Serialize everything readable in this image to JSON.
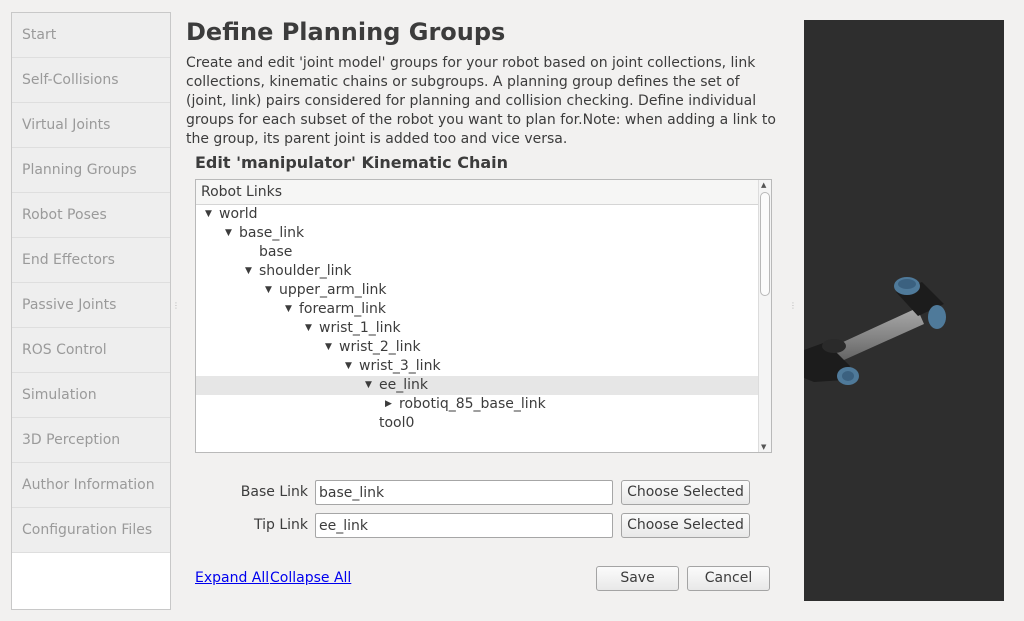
{
  "sidebar": {
    "items": [
      {
        "label": "Start"
      },
      {
        "label": "Self-Collisions"
      },
      {
        "label": "Virtual Joints"
      },
      {
        "label": "Planning Groups"
      },
      {
        "label": "Robot Poses"
      },
      {
        "label": "End Effectors"
      },
      {
        "label": "Passive Joints"
      },
      {
        "label": "ROS Control"
      },
      {
        "label": "Simulation"
      },
      {
        "label": "3D Perception"
      },
      {
        "label": "Author Information"
      },
      {
        "label": "Configuration Files"
      }
    ]
  },
  "main": {
    "title": "Define Planning Groups",
    "description": "Create and edit 'joint model' groups for your robot based on joint collections, link collections, kinematic chains or subgroups. A planning group defines the set of (joint, link) pairs considered for planning and collision checking. Define individual groups for each subset of the robot you want to plan for.Note: when adding a link to the group, its parent joint is added too and vice versa.",
    "section_title": "Edit 'manipulator' Kinematic Chain",
    "tree": {
      "header": "Robot Links",
      "nodes": [
        {
          "label": "world",
          "expander": "expanded"
        },
        {
          "label": "base_link",
          "expander": "expanded"
        },
        {
          "label": "base",
          "expander": "none"
        },
        {
          "label": "shoulder_link",
          "expander": "expanded"
        },
        {
          "label": "upper_arm_link",
          "expander": "expanded"
        },
        {
          "label": "forearm_link",
          "expander": "expanded"
        },
        {
          "label": "wrist_1_link",
          "expander": "expanded"
        },
        {
          "label": "wrist_2_link",
          "expander": "expanded"
        },
        {
          "label": "wrist_3_link",
          "expander": "expanded"
        },
        {
          "label": "ee_link",
          "expander": "expanded",
          "selected": true
        },
        {
          "label": "robotiq_85_base_link",
          "expander": "collapsed"
        },
        {
          "label": "tool0",
          "expander": "none"
        }
      ]
    },
    "base_link": {
      "label": "Base Link",
      "value": "base_link",
      "button": "Choose Selected"
    },
    "tip_link": {
      "label": "Tip Link",
      "value": "ee_link",
      "button": "Choose Selected"
    },
    "expand_all": "Expand All",
    "collapse_all": "Collapse All",
    "save": "Save",
    "cancel": "Cancel"
  },
  "colors": {
    "background": "#f2f1f0",
    "viewer_background": "#2e2e2e",
    "link": "#0000ee",
    "robot_joint_cap": "#4f7a9a"
  }
}
